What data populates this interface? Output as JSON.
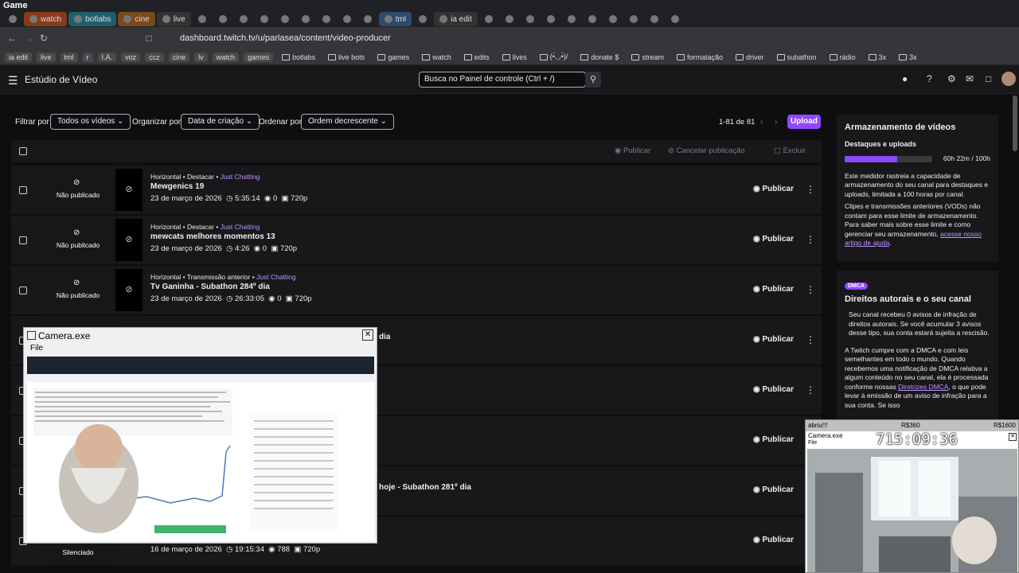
{
  "window": {
    "title": "Game"
  },
  "tabs": [
    "",
    "watch",
    "botlabs",
    "cine",
    "live",
    "",
    "",
    "",
    "",
    "",
    "",
    "",
    "",
    "",
    "tml",
    "",
    "ia edit",
    "",
    "",
    "",
    "",
    "",
    "",
    "",
    "",
    "",
    ""
  ],
  "address": {
    "url": "dashboard.twitch.tv/u/parlasea/content/video-producer"
  },
  "bookmarks": [
    "ia edit",
    "live",
    "tml",
    "r",
    "I.A.",
    "voz",
    "ccz",
    "cine",
    "lv",
    "watch",
    "games",
    "botlabs",
    "live bots",
    "games",
    "watch",
    "edits",
    "lives",
    "(•́◡•̀)/",
    "donate $",
    "stream",
    "formatação",
    "driver",
    "subathon",
    "rádio",
    "3x",
    "3x"
  ],
  "header": {
    "title": "Estúdio de Vídeo",
    "search_placeholder": "Busca no Painel de controle (Ctrl + /)"
  },
  "filters": {
    "filter_label": "Filtrar por",
    "filter_value": "Todos os vídeos",
    "org_label": "Organizar por",
    "org_value": "Data de criação",
    "sort_label": "Ordenar por",
    "sort_value": "Ordem decrescente",
    "range": "1-81 de 81",
    "upload": "Upload"
  },
  "list_actions": {
    "publish": "Publicar",
    "unpublish": "Cancelar publicação",
    "delete": "Excluir"
  },
  "rows": [
    {
      "meta": "Horizontal • Destacar • ",
      "category": "Just Chatting",
      "title": "Mewgenics 19",
      "date": "23 de março de 2026",
      "duration": "5:35:14",
      "views": "0",
      "quality": "720p",
      "status": "Não publicado",
      "action": "Publicar"
    },
    {
      "meta": "Horizontal • Destacar • ",
      "category": "Just Chatting",
      "title": "mewcats melhores momentos 13",
      "date": "23 de março de 2026",
      "duration": "4:26",
      "views": "0",
      "quality": "720p",
      "status": "Não publicado",
      "action": "Publicar"
    },
    {
      "meta": "Horizontal • Transmissão anterior • ",
      "category": "Just Chatting",
      "title": "Tv Ganinha - Subathon 284º dia",
      "date": "23 de março de 2026",
      "duration": "26:33:05",
      "views": "0",
      "quality": "720p",
      "status": "Não publicado",
      "action": "Publicar"
    },
    {
      "title_partial": "dia",
      "action": "Publicar"
    },
    {
      "action": "Publicar"
    },
    {
      "action": "Publicar"
    },
    {
      "title_partial": "hoje - Subathon 281º dia",
      "action": "Publicar"
    },
    {
      "status": "Silenciado",
      "date": "16 de março de 2026",
      "duration": "19:15:34",
      "views": "788",
      "quality": "720p",
      "action": "Publicar"
    }
  ],
  "sidebar": {
    "storage_title": "Armazenamento de vídeos",
    "storage_sub": "Destaques e uploads",
    "storage_value": "60h 22m / 100h",
    "storage_fraction": 0.6037,
    "storage_text1": "Este medidor rastreia a capacidade de armazenamento do seu canal para destaques e uploads, limitada a 100 horas por canal.",
    "storage_text2": "Clipes e transmissões anteriores (VODs) não contam para esse limite de armazenamento. Para saber mais sobre esse limite e como gerenciar seu armazenamento,",
    "storage_link": "acesse nosso artigo de ajuda",
    "dmca_badge": "DMCA",
    "copyright_title": "Direitos autorais e o seu canal",
    "copyright_text": "Seu canal recebeu 0 avisos de infração de direitos autorais. Se você acumular 3 avisos desse tipo, sua conta estará sujeita a rescisão.",
    "dmca_text1": "A Twitch cumpre com a DMCA e com leis semelhantes em todo o mundo. Quando recebemos uma notificação de DMCA relativa a algum conteúdo no seu canal, ela é processada conforme nossas",
    "dmca_link": "Diretrizes DMCA",
    "dmca_text2": ", o que pode levar à emissão de um aviso de infração para a sua conta. Se isso"
  },
  "camera1": {
    "title": "Camera.exe",
    "menu": "File"
  },
  "camera2": {
    "ticker_left": "abriu!!!",
    "ticker_mid": "R$360",
    "ticker_right": "R$1600",
    "title": "Camera.exe",
    "menu": "File",
    "timer": "715:09:36"
  }
}
